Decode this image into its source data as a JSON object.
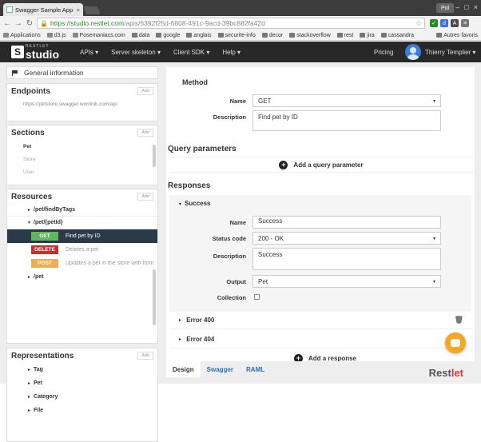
{
  "browser": {
    "tab_title": "Swagger Sample App",
    "url_host": "https://studio.restlet.com",
    "url_path": "/apis/6392f25d-6808-491c-9acd-39bc882fa42d",
    "user_badge": "Pol",
    "bookmarks": [
      "Applications",
      "d3.js",
      "Posemaniacs.com",
      "data",
      "google",
      "anglais",
      "securite-info",
      "decor",
      "stackoverflow",
      "rest",
      "jira",
      "cassandra"
    ],
    "bookmarks_more": "Autres favoris"
  },
  "app": {
    "logo_top": "RESTLET",
    "logo_main": "studio",
    "menu": [
      "APIs ▾",
      "Server skeleton ▾",
      "Client SDK ▾",
      "Help ▾"
    ],
    "pricing": "Pricing",
    "user_name": "Thierry Templier ▾"
  },
  "sidebar": {
    "general": "General information",
    "add": "Add",
    "endpoints": {
      "title": "Endpoints",
      "url": "https://petstore.swagger.wordnik.com/api"
    },
    "sections": {
      "title": "Sections",
      "items": [
        "Pet",
        "Store",
        "User"
      ]
    },
    "resources": {
      "title": "Resources",
      "r1": "/pet/findByTags",
      "r2": "/pet/{petId}",
      "methods": [
        {
          "verb": "GET",
          "desc": "Find pet by ID"
        },
        {
          "verb": "DELETE",
          "desc": "Deletes a pet"
        },
        {
          "verb": "POST",
          "desc": "Updates a pet in the store with form"
        }
      ],
      "r3": "/pet"
    },
    "representations": {
      "title": "Representations",
      "items": [
        "Tag",
        "Pet",
        "Category",
        "File"
      ]
    }
  },
  "editor": {
    "method_title": "Method",
    "name_label": "Name",
    "name_value": "GET",
    "desc_label": "Description",
    "desc_value": "Find pet by ID",
    "query_title": "Query parameters",
    "add_query": "Add a query parameter",
    "responses_title": "Responses",
    "success": {
      "head": "Success",
      "name_label": "Name",
      "name_value": "Success",
      "status_label": "Status code",
      "status_value": "200 - OK",
      "desc_label": "Description",
      "desc_value": "Success",
      "output_label": "Output",
      "output_value": "Pet",
      "coll_label": "Collection"
    },
    "error1": "Error 400",
    "error2": "Error 404",
    "add_response": "Add a response"
  },
  "bottom": {
    "tabs": [
      "Design",
      "Swagger",
      "RAML"
    ],
    "logo_a": "Rest",
    "logo_b": "let"
  },
  "colors": {
    "get": "#5cb85c",
    "delete": "#c9302c",
    "post": "#f0ad4e",
    "selected": "#2b3a48",
    "fab": "#f5a623"
  }
}
